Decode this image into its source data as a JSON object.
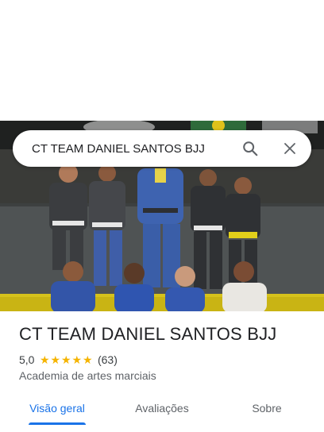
{
  "search": {
    "query": "CT TEAM DANIEL SANTOS BJJ"
  },
  "place": {
    "name": "CT TEAM DANIEL SANTOS BJJ",
    "rating": "5,0",
    "stars": 5,
    "review_count": "(63)",
    "category": "Academia de artes marciais"
  },
  "tabs": [
    {
      "label": "Visão geral",
      "active": true
    },
    {
      "label": "Avaliações",
      "active": false
    },
    {
      "label": "Sobre",
      "active": false
    }
  ],
  "colors": {
    "accent": "#1a73e8",
    "star": "#f5b400",
    "text": "#202124",
    "secondary_text": "#5f6368"
  },
  "icons": {
    "search": "search-icon",
    "close": "close-icon",
    "star": "star-icon"
  }
}
